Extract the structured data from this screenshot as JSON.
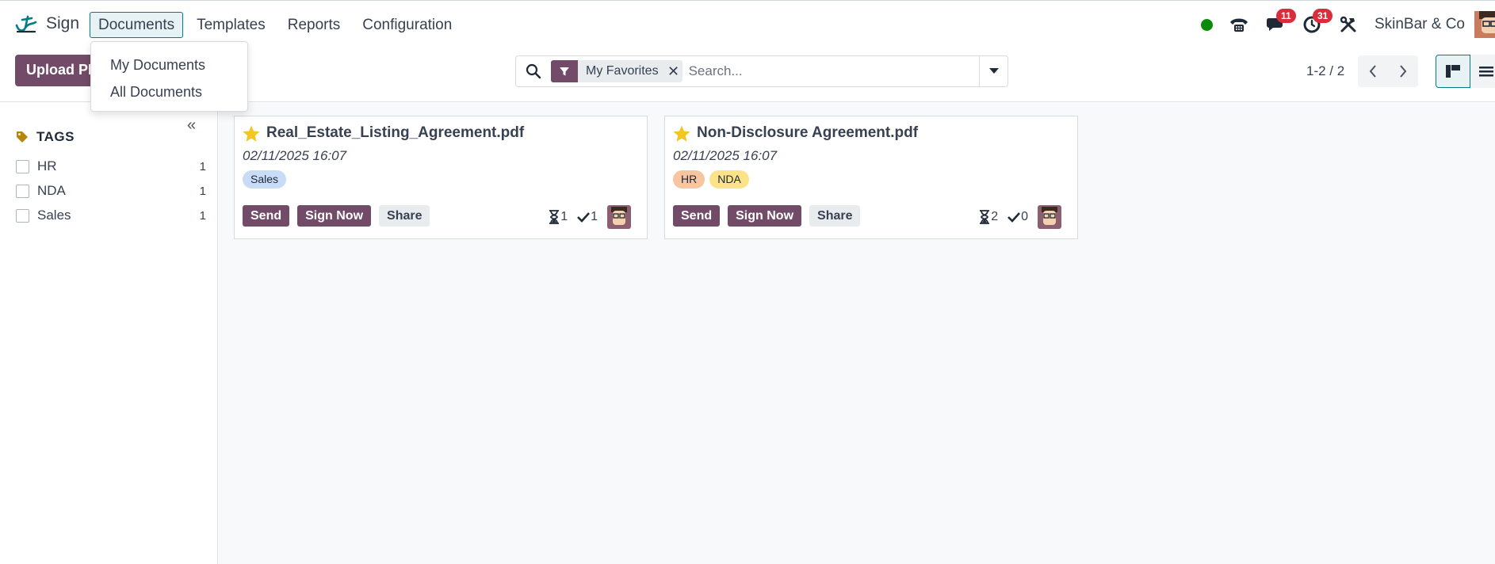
{
  "app": {
    "name": "Sign"
  },
  "menu": {
    "items": [
      "Documents",
      "Templates",
      "Reports",
      "Configuration"
    ],
    "active": "Documents"
  },
  "dropdown": {
    "items": [
      "My Documents",
      "All Documents"
    ]
  },
  "systray": {
    "messages_count": "11",
    "activities_count": "31",
    "company": "SkinBar & Co",
    "presence_color": "#0a8a0a"
  },
  "control": {
    "upload_label": "Upload PDF",
    "search": {
      "facet": "My Favorites",
      "placeholder": "Search..."
    },
    "pager": "1-2 / 2"
  },
  "sidebar": {
    "title": "TAGS",
    "tags": [
      {
        "name": "HR",
        "count": "1"
      },
      {
        "name": "NDA",
        "count": "1"
      },
      {
        "name": "Sales",
        "count": "1"
      }
    ]
  },
  "cards": [
    {
      "title": "Real_Estate_Listing_Agreement.pdf",
      "date": "02/11/2025 16:07",
      "tags": [
        "Sales"
      ],
      "actions": [
        "Send",
        "Sign Now",
        "Share"
      ],
      "waiting": "1",
      "signed": "1"
    },
    {
      "title": "Non-Disclosure Agreement.pdf",
      "date": "02/11/2025 16:07",
      "tags": [
        "HR",
        "NDA"
      ],
      "actions": [
        "Send",
        "Sign Now",
        "Share"
      ],
      "waiting": "2",
      "signed": "0"
    }
  ],
  "colors": {
    "brand": "#714b67",
    "accent": "#017e84",
    "star": "#f3c623",
    "badge": "#d92d3c"
  }
}
